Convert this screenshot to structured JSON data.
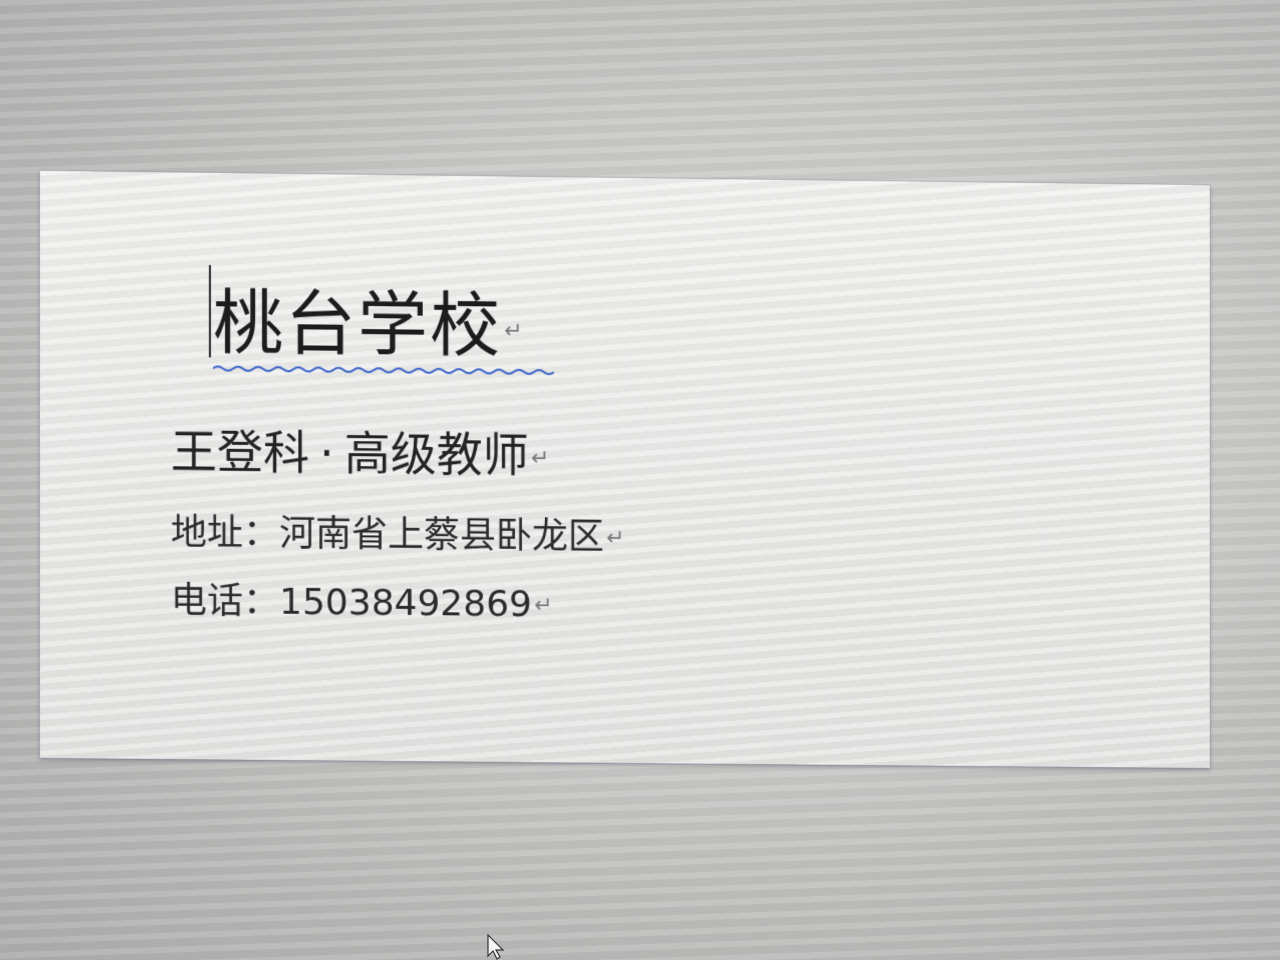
{
  "card": {
    "school_name": "桃台学校",
    "name": "王登科",
    "title": "高级教师",
    "address_label": "地址：",
    "address_value": "河南省上蔡县卧龙区",
    "phone_label": "电话：",
    "phone_value": "15038492869"
  },
  "marks": {
    "paragraph_mark": "↵",
    "separator": "·"
  },
  "colors": {
    "spell_underline": "#3a62c8",
    "text": "#1c1c1c"
  }
}
